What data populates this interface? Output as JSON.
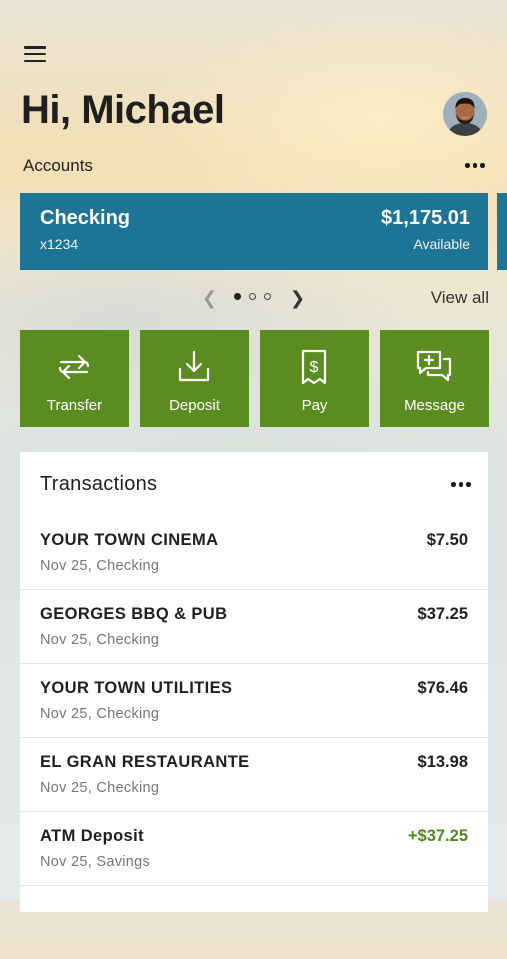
{
  "header": {
    "greeting": "Hi, Michael",
    "menu_icon": "hamburger-menu-icon",
    "avatar": "user-avatar"
  },
  "accounts": {
    "label": "Accounts",
    "more_icon": "more-horizontal-icon",
    "cards": [
      {
        "name": "Checking",
        "number": "x1234",
        "balance": "$1,175.01",
        "balance_label": "Available",
        "color": "#1d7494"
      }
    ],
    "pager": {
      "total_pages": 3,
      "current_page": 1,
      "prev_icon": "chevron-left-icon",
      "next_icon": "chevron-right-icon"
    },
    "view_all": "View all"
  },
  "actions": [
    {
      "label": "Transfer",
      "icon": "transfer-arrows-icon"
    },
    {
      "label": "Deposit",
      "icon": "deposit-download-icon"
    },
    {
      "label": "Pay",
      "icon": "pay-bill-icon"
    },
    {
      "label": "Message",
      "icon": "message-add-icon"
    }
  ],
  "action_color": "#5b8c22",
  "transactions": {
    "title": "Transactions",
    "more_icon": "more-horizontal-icon",
    "items": [
      {
        "name": "YOUR TOWN CINEMA",
        "date_account": "Nov 25, Checking",
        "amount": "$7.50",
        "type": "debit"
      },
      {
        "name": "GEORGES BBQ & PUB",
        "date_account": "Nov 25, Checking",
        "amount": "$37.25",
        "type": "debit"
      },
      {
        "name": "YOUR TOWN UTILITIES",
        "date_account": "Nov 25, Checking",
        "amount": "$76.46",
        "type": "debit"
      },
      {
        "name": "EL GRAN RESTAURANTE",
        "date_account": "Nov 25, Checking",
        "amount": "$13.98",
        "type": "debit"
      },
      {
        "name": "ATM Deposit",
        "date_account": "Nov 25, Savings",
        "amount": "+$37.25",
        "type": "credit"
      }
    ],
    "credit_color": "#4f8a1f"
  }
}
